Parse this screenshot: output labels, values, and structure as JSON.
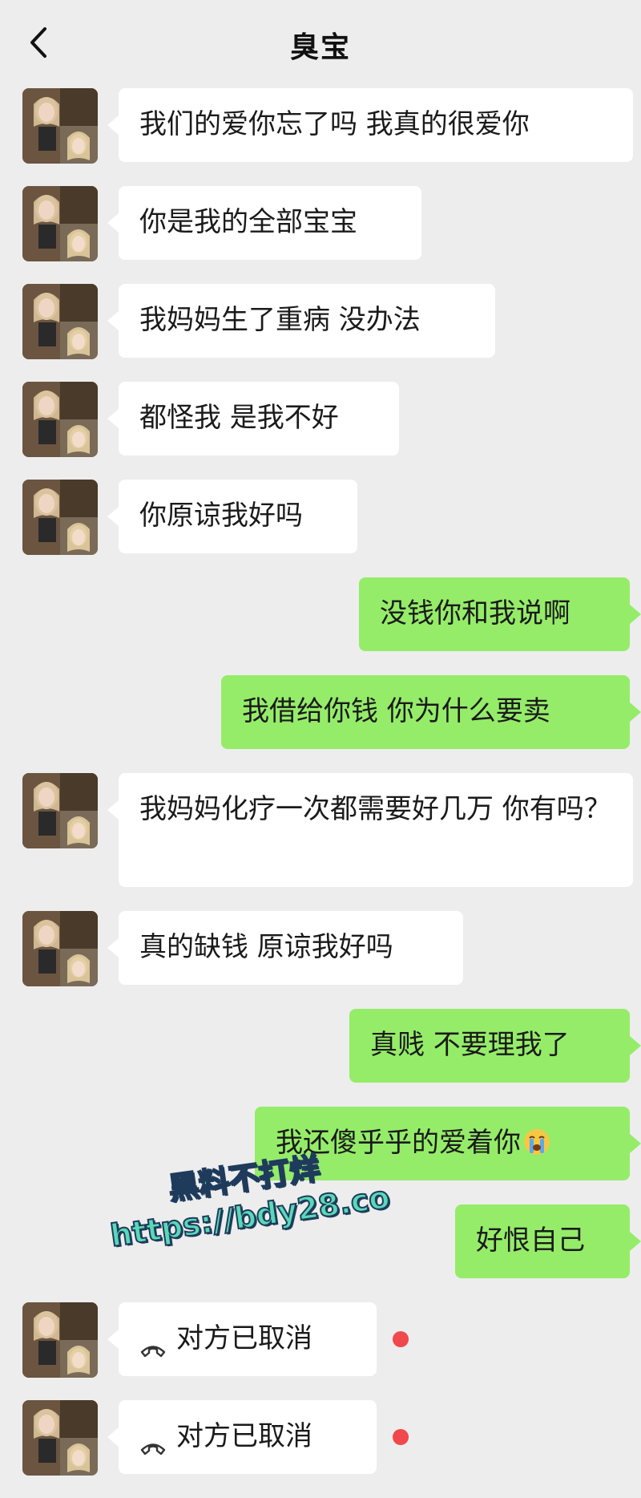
{
  "header": {
    "title": "臭宝"
  },
  "messages": [
    {
      "text": "我们的爱你忘了吗 我真的很爱你"
    },
    {
      "text": "你是我的全部宝宝"
    },
    {
      "text": "我妈妈生了重病 没办法"
    },
    {
      "text": "都怪我 是我不好"
    },
    {
      "text": "你原谅我好吗"
    },
    {
      "text": "没钱你和我说啊"
    },
    {
      "text": "我借给你钱 你为什么要卖"
    },
    {
      "text": "我妈妈化疗一次都需要好几万 你有吗？"
    },
    {
      "text": "真的缺钱 原谅我好吗"
    },
    {
      "text": "真贱 不要理我了"
    },
    {
      "text": "我还傻乎乎的爱着你",
      "emoji": "loudly-crying-face"
    },
    {
      "text": "好恨自己"
    }
  ],
  "calls": [
    {
      "text": "对方已取消",
      "status_color": "#f0484c"
    },
    {
      "text": "对方已取消",
      "status_color": "#f0484c"
    }
  ],
  "watermark": {
    "line1": "黑料不打烊",
    "line2": "https://bdy28.co"
  },
  "colors": {
    "incoming": "#ffffff",
    "outgoing": "#95ec69",
    "background": "#ededed"
  }
}
